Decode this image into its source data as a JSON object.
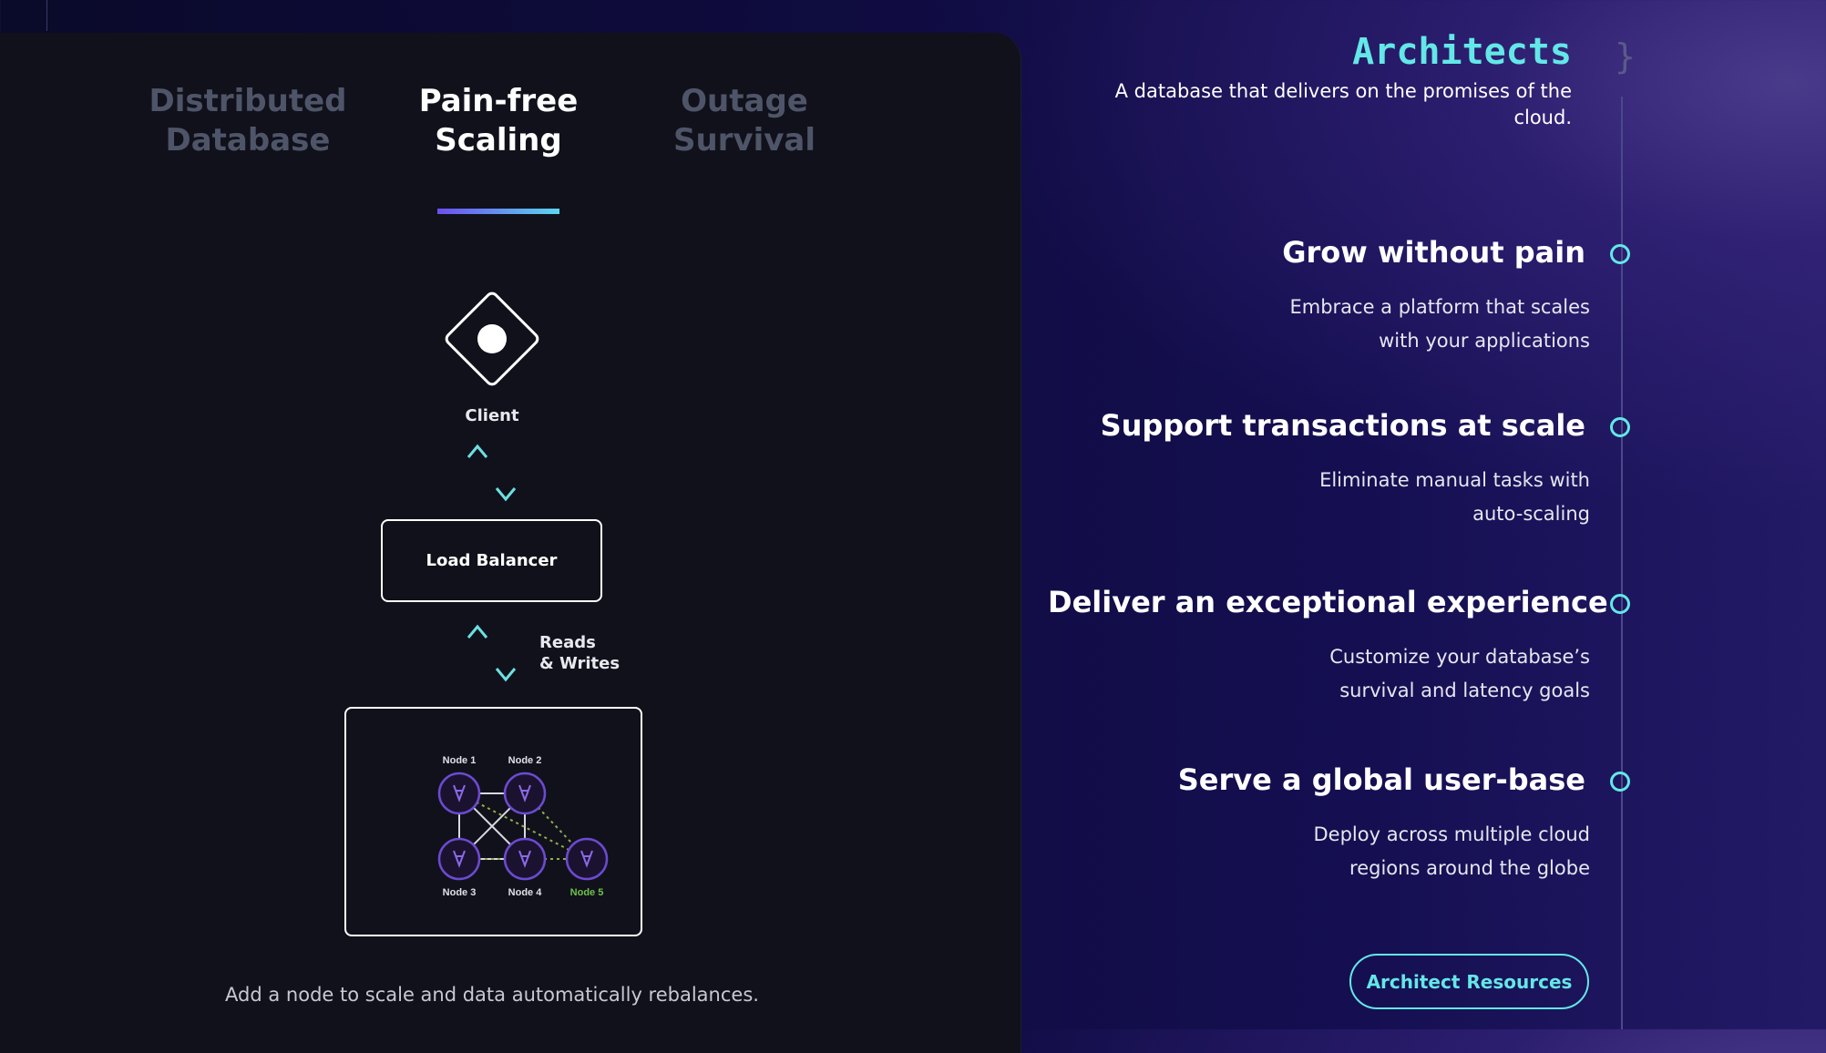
{
  "tabs": [
    {
      "label_line1": "Distributed",
      "label_line2": "Database",
      "active": false
    },
    {
      "label_line1": "Pain-free",
      "label_line2": "Scaling",
      "active": true
    },
    {
      "label_line1": "Outage",
      "label_line2": "Survival",
      "active": false
    }
  ],
  "diagram": {
    "client_label": "Client",
    "load_balancer_label": "Load Balancer",
    "reads_label_line1": "Reads",
    "reads_label_line2": "& Writes",
    "nodes": [
      "Node 1",
      "Node 2",
      "Node 3",
      "Node 4",
      "Node 5"
    ],
    "caption": "Add a node to scale and data automatically rebalances."
  },
  "architects": {
    "title": "Architects",
    "subtitle_line1": "A database that delivers on the promises of the",
    "subtitle_line2": "cloud.",
    "brace": "}",
    "features": [
      {
        "title": "Grow without pain",
        "desc_line1": "Embrace a platform that scales",
        "desc_line2": "with your applications"
      },
      {
        "title": "Support transactions at scale",
        "desc_line1": "Eliminate manual tasks with",
        "desc_line2": "auto-scaling"
      },
      {
        "title": "Deliver an exceptional experience",
        "desc_line1": "Customize your database’s",
        "desc_line2": "survival and latency goals"
      },
      {
        "title": "Serve a global user-base",
        "desc_line1": "Deploy across multiple cloud",
        "desc_line2": "regions around the globe"
      }
    ],
    "cta_label": "Architect Resources"
  },
  "colors": {
    "accent_cyan": "#63e7e7",
    "node_purple": "#6b4bd0",
    "node5_green": "#6fc24a",
    "panel_bg": "#11111c"
  }
}
